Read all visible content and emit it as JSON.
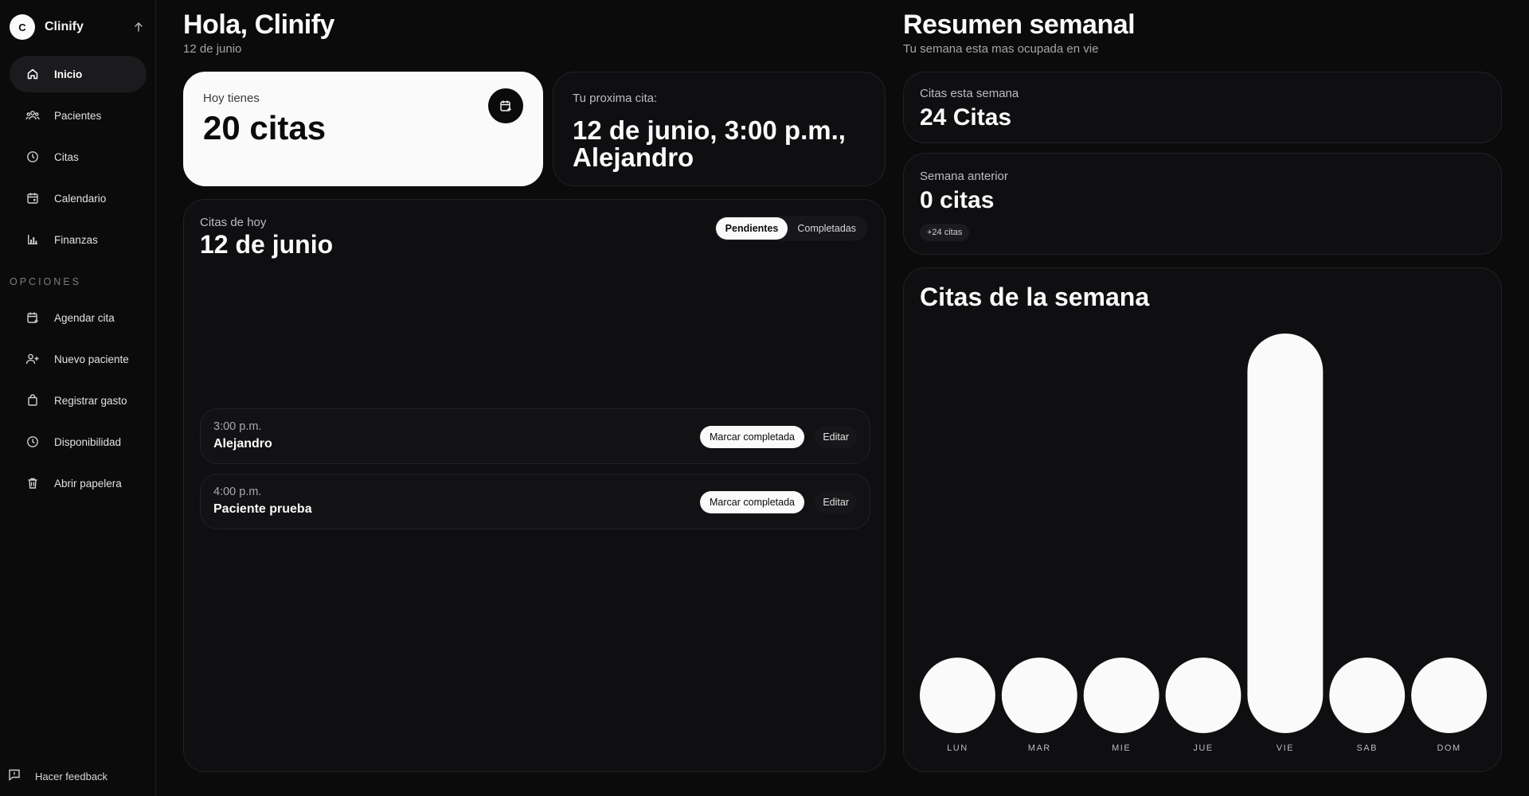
{
  "sidebar": {
    "brand_initial": "C",
    "brand_name": "Clinify",
    "nav": [
      {
        "label": "Inicio",
        "active": true
      },
      {
        "label": "Pacientes"
      },
      {
        "label": "Citas"
      },
      {
        "label": "Calendario"
      },
      {
        "label": "Finanzas"
      }
    ],
    "options_label": "OPCIONES",
    "options": [
      {
        "label": "Agendar cita"
      },
      {
        "label": "Nuevo paciente"
      },
      {
        "label": "Registrar gasto"
      },
      {
        "label": "Disponibilidad"
      },
      {
        "label": "Abrir papelera"
      }
    ],
    "feedback_label": "Hacer feedback"
  },
  "header": {
    "title": "Hola, Clinify",
    "date": "12 de junio"
  },
  "today_card": {
    "label": "Hoy tienes",
    "count": "20 citas"
  },
  "next_card": {
    "label": "Tu proxima cita:",
    "value": "12 de junio, 3:00 p.m., Alejandro"
  },
  "today_list": {
    "label": "Citas de hoy",
    "date": "12 de junio",
    "tabs": [
      "Pendientes",
      "Completadas"
    ],
    "active_tab": "Pendientes",
    "appointments": [
      {
        "time": "3:00 p.m.",
        "name": "Alejandro",
        "complete_label": "Marcar completada",
        "edit_label": "Editar"
      },
      {
        "time": "4:00 p.m.",
        "name": "Paciente prueba",
        "complete_label": "Marcar completada",
        "edit_label": "Editar"
      }
    ]
  },
  "summary": {
    "title": "Resumen semanal",
    "subtitle": "Tu semana esta mas ocupada en vie",
    "this_week_label": "Citas esta semana",
    "this_week_value": "24 Citas",
    "prev_week_label": "Semana anterior",
    "prev_week_value": "0 citas",
    "delta_badge": "+24 citas"
  },
  "chart_data": {
    "type": "bar",
    "title": "Citas de la semana",
    "categories": [
      "LUN",
      "MAR",
      "MIE",
      "JUE",
      "VIE",
      "SAB",
      "DOM"
    ],
    "values": [
      0,
      0,
      0,
      0,
      20,
      1,
      0
    ],
    "ylim": [
      0,
      20
    ],
    "grid": false,
    "bar_color": "#fafafa"
  }
}
